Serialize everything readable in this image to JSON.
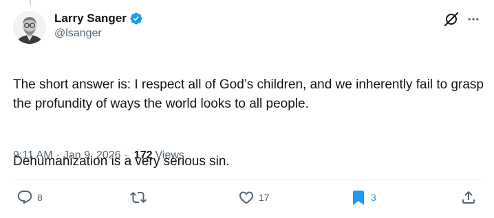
{
  "author": {
    "name": "Larry Sanger",
    "handle": "@lsanger",
    "verified_color": "#1d9bf0"
  },
  "post": {
    "paragraph_1": "The short answer is: I respect all of God’s children, and we inherently fail to grasp the profundity of ways the world looks to all people.",
    "paragraph_2": "Dehumanization is a very serious sin."
  },
  "meta": {
    "time": "9:11 AM",
    "separator": "·",
    "date": "Jan 9, 2026",
    "views_count": "172",
    "views_label": "Views"
  },
  "actions": {
    "replies": "8",
    "reposts": "",
    "likes": "17",
    "bookmarks": "3"
  },
  "icons": {
    "reply": "reply-icon",
    "repost": "repost-icon",
    "like": "heart-icon",
    "bookmark": "bookmark-icon",
    "share": "share-icon",
    "grok": "grok-icon",
    "more": "more-icon"
  },
  "colors": {
    "text": "#0f1419",
    "secondary": "#536471",
    "accent": "#1d9bf0"
  }
}
